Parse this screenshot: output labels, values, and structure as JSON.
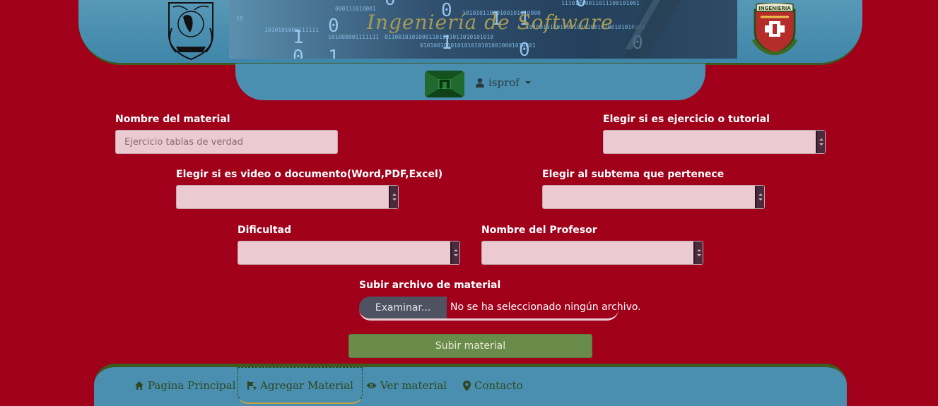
{
  "header": {
    "banner_title": "Ingeniería de Software",
    "unam_logo_icon": "unam-shield-icon",
    "faculty_logo_icon": "ingenieria-shield-icon"
  },
  "userbar": {
    "username": "isprof",
    "user_icon": "user-icon"
  },
  "form": {
    "material_name": {
      "label": "Nombre del material",
      "placeholder": "Ejercicio tablas de verdad"
    },
    "exercise_type": {
      "label": "Elegir si es ejercicio o tutorial"
    },
    "media_type": {
      "label": "Elegir si es video o documento(Word,PDF,Excel)"
    },
    "subtopic": {
      "label": "Elegir al subtema que pertenece"
    },
    "difficulty": {
      "label": "Dificultad"
    },
    "professor": {
      "label": "Nombre del Profesor"
    },
    "file_upload": {
      "label": "Subir archivo de material",
      "button": "Examinar...",
      "status": "No se ha seleccionado ningún archivo."
    },
    "submit_label": "Subir material"
  },
  "nav": {
    "items": [
      {
        "label": "Pagina Principal",
        "icon": "home-icon",
        "active": false
      },
      {
        "label": "Agregar Material",
        "icon": "flag-add-icon",
        "active": true
      },
      {
        "label": "Ver material",
        "icon": "eye-icon",
        "active": false
      },
      {
        "label": "Contacto",
        "icon": "map-marker-icon",
        "active": false
      }
    ]
  },
  "colors": {
    "background": "#a1001b",
    "panel": "#4a8fb0",
    "accent_green": "#6a8c4a",
    "input_bg": "#ebcbd1"
  }
}
